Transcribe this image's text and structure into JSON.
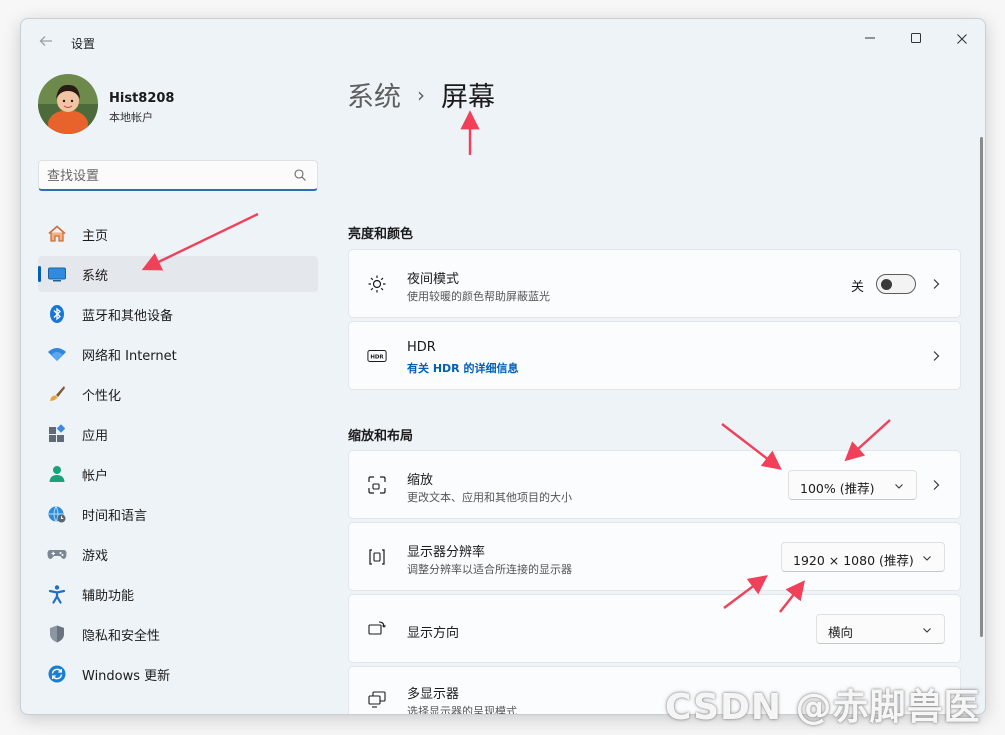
{
  "window": {
    "title": "设置"
  },
  "profile": {
    "name": "Hist8208",
    "account_type": "本地帐户"
  },
  "search": {
    "placeholder": "查找设置"
  },
  "nav": {
    "items": [
      {
        "label": "主页",
        "icon": "home-icon"
      },
      {
        "label": "系统",
        "icon": "system-icon",
        "active": true
      },
      {
        "label": "蓝牙和其他设备",
        "icon": "bluetooth-icon"
      },
      {
        "label": "网络和 Internet",
        "icon": "wifi-icon"
      },
      {
        "label": "个性化",
        "icon": "brush-icon"
      },
      {
        "label": "应用",
        "icon": "apps-icon"
      },
      {
        "label": "帐户",
        "icon": "account-icon"
      },
      {
        "label": "时间和语言",
        "icon": "globe-clock-icon"
      },
      {
        "label": "游戏",
        "icon": "gamepad-icon"
      },
      {
        "label": "辅助功能",
        "icon": "accessibility-icon"
      },
      {
        "label": "隐私和安全性",
        "icon": "shield-icon"
      },
      {
        "label": "Windows 更新",
        "icon": "update-icon"
      }
    ]
  },
  "breadcrumb": {
    "parent": "系统",
    "separator": "›",
    "current": "屏幕"
  },
  "sections": {
    "brightness": {
      "title": "亮度和颜色"
    },
    "scale_layout": {
      "title": "缩放和布局"
    }
  },
  "night_light": {
    "title": "夜间模式",
    "subtitle": "使用较暖的颜色帮助屏蔽蓝光",
    "state_label": "关",
    "on": false
  },
  "hdr": {
    "title": "HDR",
    "link": "有关 HDR 的详细信息"
  },
  "scale": {
    "title": "缩放",
    "subtitle": "更改文本、应用和其他项目的大小",
    "value": "100% (推荐)"
  },
  "resolution": {
    "title": "显示器分辨率",
    "subtitle": "调整分辨率以适合所连接的显示器",
    "value": "1920 × 1080 (推荐)"
  },
  "orientation": {
    "title": "显示方向",
    "value": "横向"
  },
  "multi_display": {
    "title": "多显示器",
    "subtitle": "选择显示器的呈现模式"
  },
  "watermark": {
    "text": "CSDN @赤脚兽医"
  },
  "colors": {
    "accent": "#005fb8",
    "annotation": "#f0405a",
    "window_bg": "#eef3f8",
    "card_bg": "#fbfcfd"
  }
}
